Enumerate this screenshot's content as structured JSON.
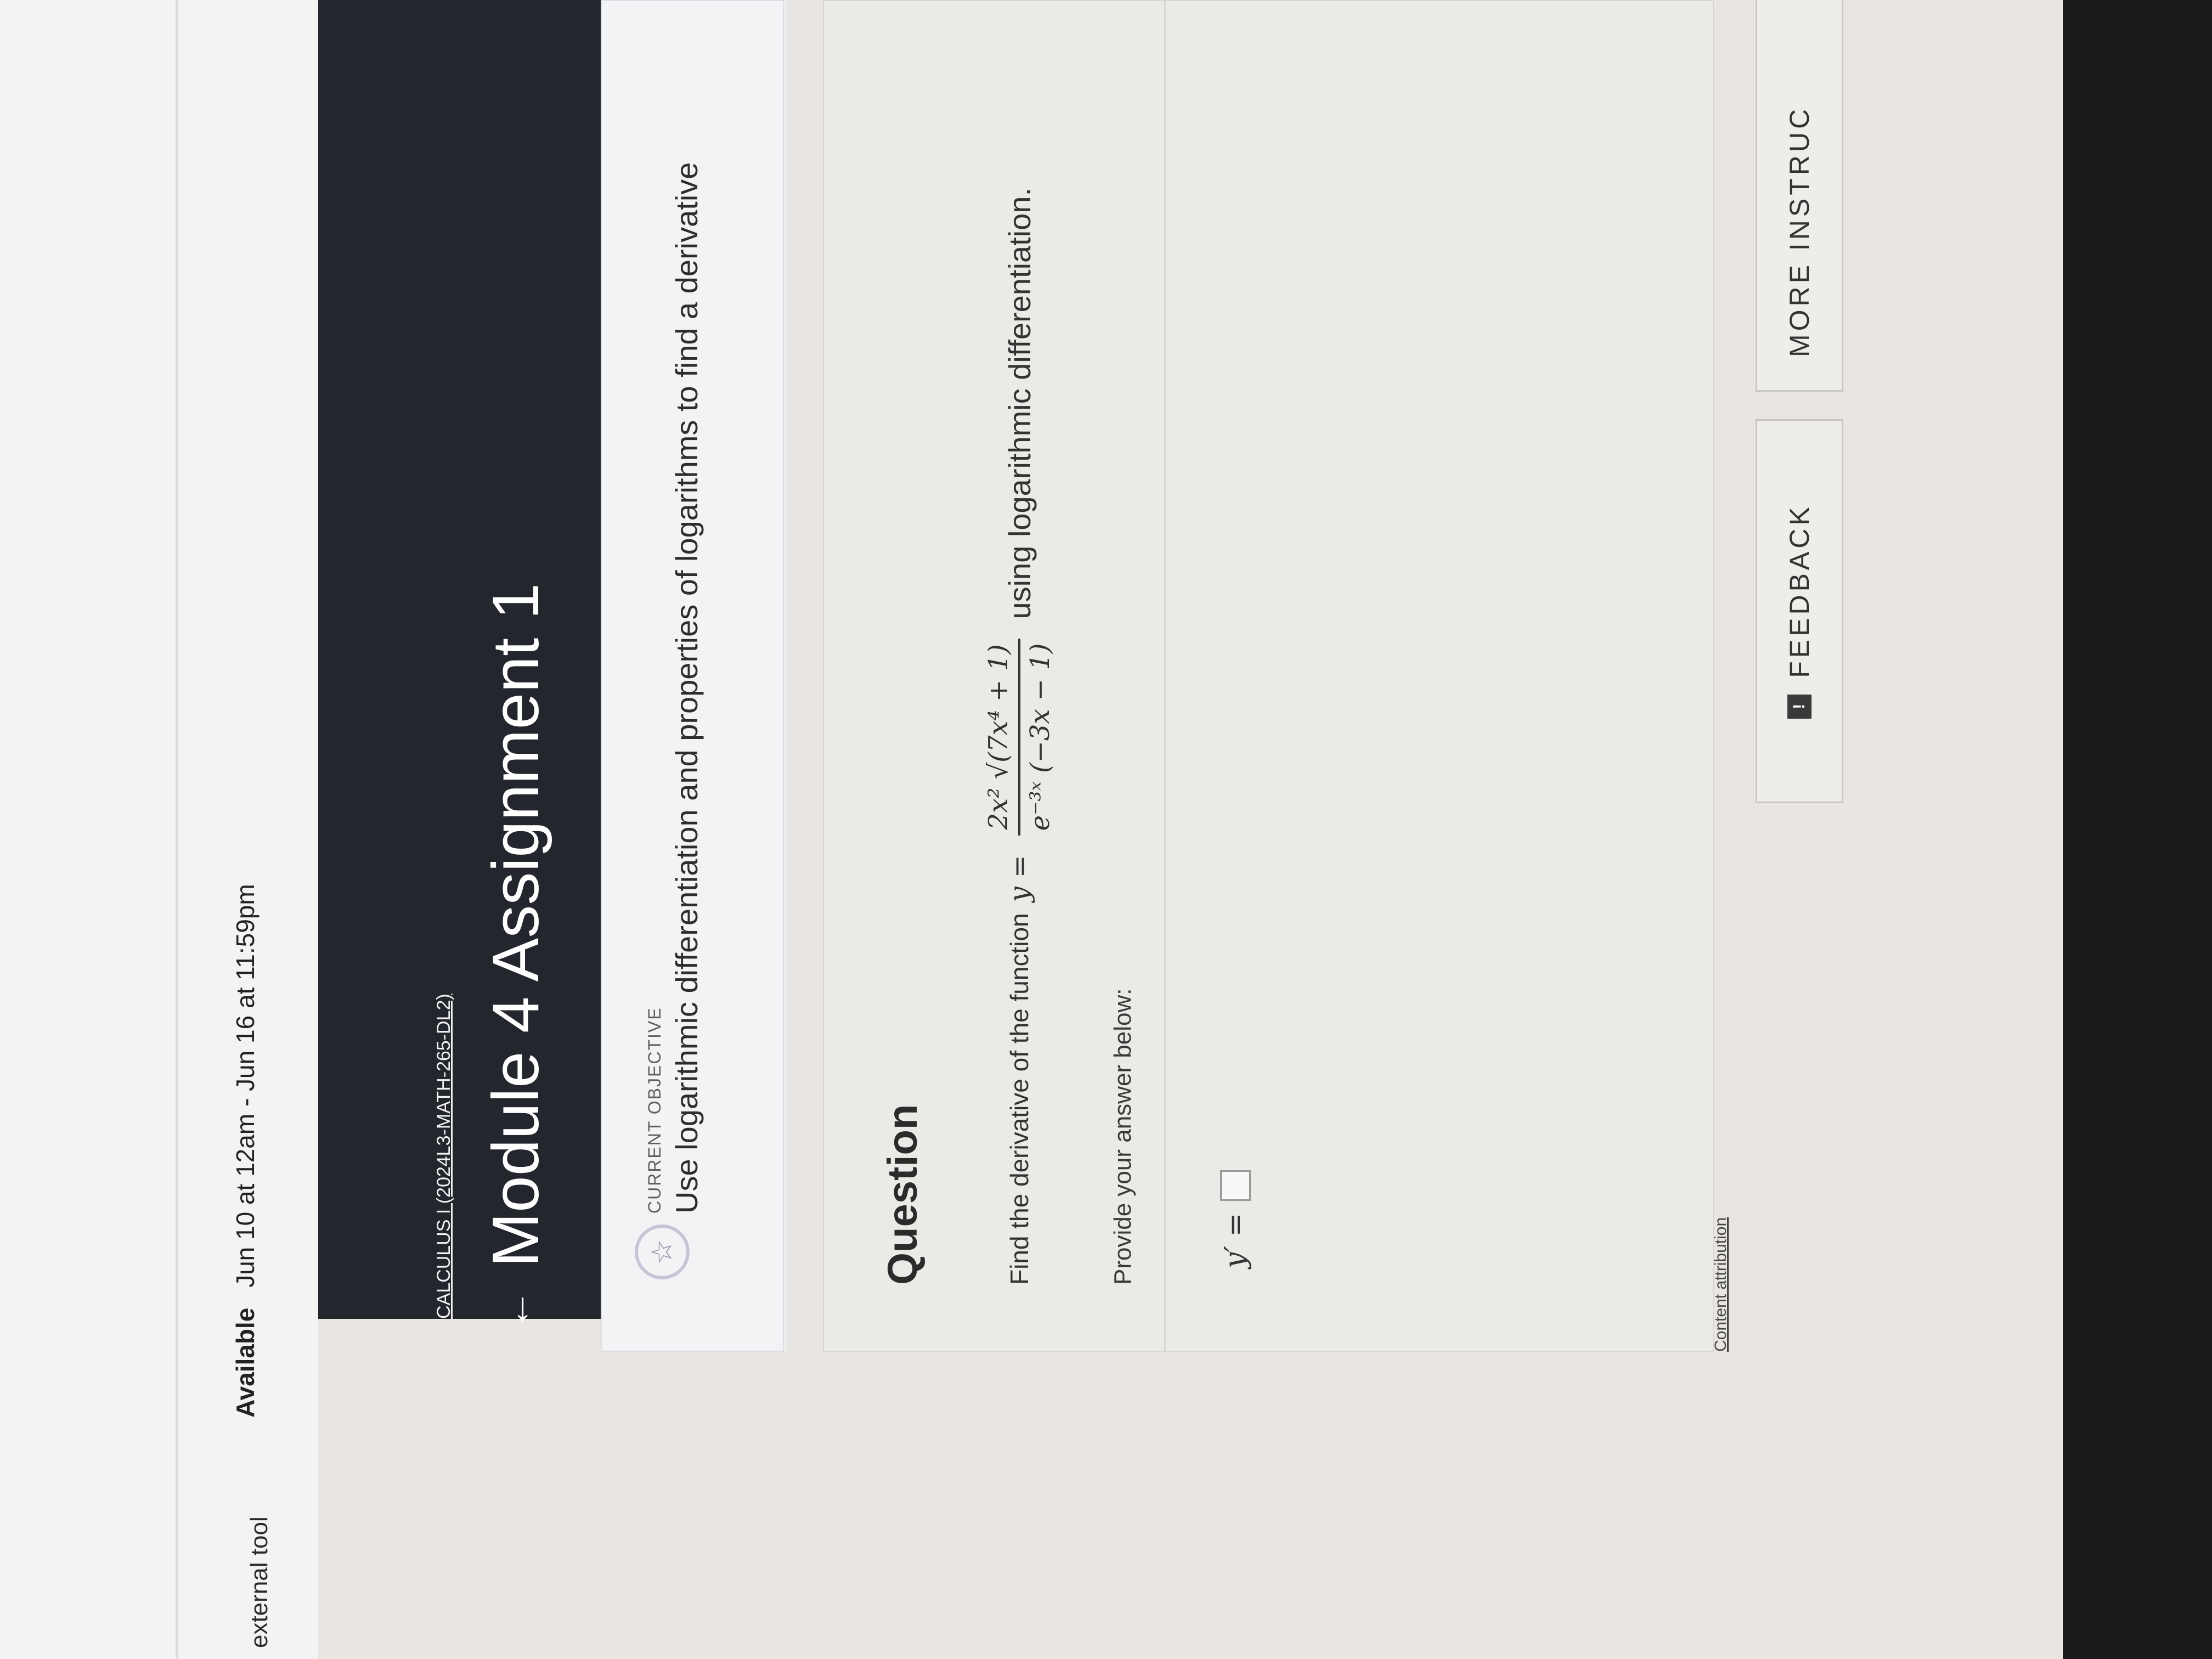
{
  "lms": {
    "tool_label": "external tool",
    "available_label": "Available",
    "available_dates": "Jun 10 at 12am - Jun 16 at 11:59pm"
  },
  "header": {
    "course": "CALCULUS I (2024L3-MATH-265-DL2)",
    "back_icon": "arrow-left-icon",
    "title": "Module 4 Assignment 1"
  },
  "objective": {
    "icon": "star-icon",
    "label": "CURRENT OBJECTIVE",
    "text": "Use logarithmic differentiation and properties of logarithms to find a derivative"
  },
  "question": {
    "heading": "Question",
    "prompt_prefix": "Find the derivative of the function",
    "function_lhs": "y =",
    "numerator": "2x² √(7x⁴ + 1)",
    "denominator": "e⁻³ˣ (−3x − 1)",
    "prompt_suffix": "using logarithmic differentiation.",
    "provide": "Provide your answer below:",
    "answer_label": "y′ =",
    "answer_value": ""
  },
  "footer": {
    "attribution": "Content attribution",
    "feedback_label": "FEEDBACK",
    "more_label": "MORE INSTRUC"
  }
}
